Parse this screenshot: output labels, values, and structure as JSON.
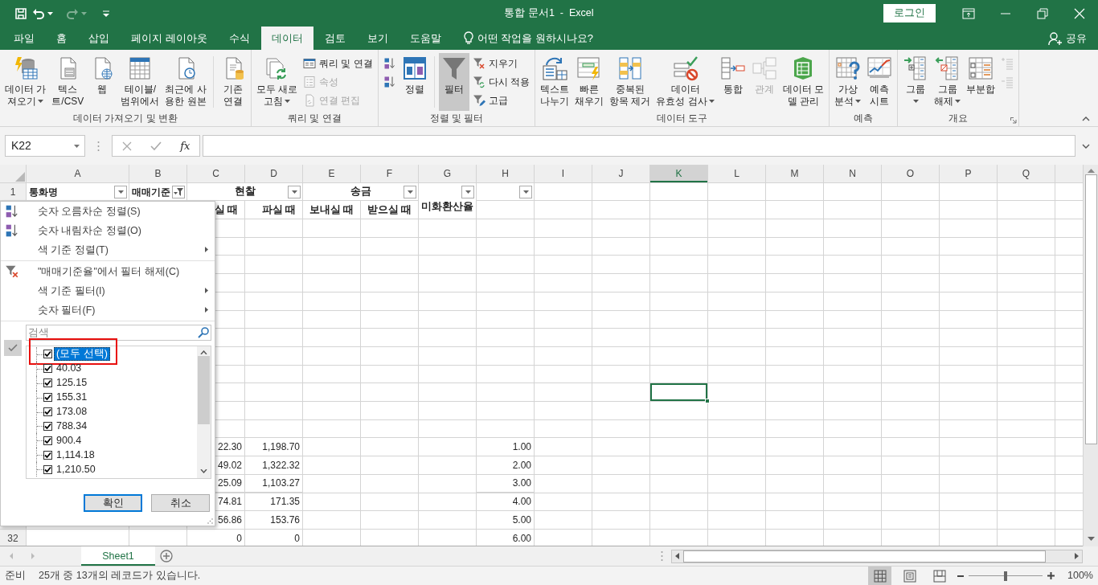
{
  "title_bar": {
    "quick_access": [
      {
        "kind": "save"
      },
      {
        "kind": "undo",
        "disabled": false
      },
      {
        "kind": "redo",
        "disabled": true
      },
      {
        "kind": "customize"
      }
    ],
    "title": "통합 문서1  -  Excel",
    "sign_in": "로그인"
  },
  "tabs": [
    {
      "label": "파일",
      "selected": false
    },
    {
      "label": "홈",
      "selected": false
    },
    {
      "label": "삽입",
      "selected": false
    },
    {
      "label": "페이지 레이아웃",
      "selected": false
    },
    {
      "label": "수식",
      "selected": false
    },
    {
      "label": "데이터",
      "selected": true
    },
    {
      "label": "검토",
      "selected": false
    },
    {
      "label": "보기",
      "selected": false
    },
    {
      "label": "도움말",
      "selected": false
    }
  ],
  "tell_me": "어떤 작업을 원하시나요?",
  "share": "공유",
  "ribbon": {
    "groups": [
      {
        "label": "데이터 가져오기 및 변환",
        "controls": [
          {
            "kind": "large",
            "lines": [
              "데이터 가",
              "져오기"
            ],
            "menu": true
          },
          {
            "kind": "large",
            "lines": [
              "텍스",
              "트/CSV"
            ]
          },
          {
            "kind": "large",
            "lines": [
              "웹"
            ]
          },
          {
            "kind": "large",
            "lines": [
              "테이블/",
              "범위에서"
            ]
          },
          {
            "kind": "large",
            "lines": [
              "최근에 사",
              "용한 원본"
            ]
          },
          {
            "kind": "separator"
          },
          {
            "kind": "large",
            "lines": [
              "기존",
              "연결"
            ]
          }
        ]
      },
      {
        "label": "쿼리 및 연결",
        "controls": [
          {
            "kind": "large",
            "lines": [
              "모두 새로",
              "고침"
            ],
            "menu": true
          },
          {
            "kind": "stack",
            "items": [
              {
                "label": "쿼리 및 연결",
                "disabled": false
              },
              {
                "label": "속성",
                "disabled": true
              },
              {
                "label": "연결 편집",
                "disabled": true
              }
            ]
          }
        ]
      },
      {
        "label": "정렬 및 필터",
        "controls": [
          {
            "kind": "stack",
            "items": [
              {
                "disabled": false
              },
              {
                "disabled": false
              }
            ]
          },
          {
            "kind": "large",
            "lines": [
              "정렬"
            ]
          },
          {
            "kind": "separator"
          },
          {
            "kind": "large",
            "lines": [
              "필터"
            ],
            "pressed": true
          },
          {
            "kind": "stack",
            "items": [
              {
                "label": "지우기",
                "disabled": false
              },
              {
                "label": "다시 적용",
                "disabled": false
              },
              {
                "label": "고급",
                "disabled": false
              }
            ]
          }
        ]
      },
      {
        "label": "데이터 도구",
        "controls": [
          {
            "kind": "large",
            "lines": [
              "텍스트",
              "나누기"
            ]
          },
          {
            "kind": "large",
            "lines": [
              "빠른",
              "채우기"
            ]
          },
          {
            "kind": "large",
            "lines": [
              "중복된",
              "항목 제거"
            ]
          },
          {
            "kind": "large",
            "lines": [
              "데이터",
              "유효성 검사"
            ],
            "menu": true
          },
          {
            "kind": "large",
            "lines": [
              "통합"
            ]
          },
          {
            "kind": "large",
            "lines": [
              "관계"
            ],
            "disabled": true
          },
          {
            "kind": "large",
            "lines": [
              "데이터 모",
              "델 관리"
            ]
          }
        ]
      },
      {
        "label": "예측",
        "controls": [
          {
            "kind": "large",
            "lines": [
              "가상",
              "분석"
            ],
            "menu": true
          },
          {
            "kind": "large",
            "lines": [
              "예측",
              "시트"
            ]
          }
        ]
      },
      {
        "label": "개요",
        "launcher": true,
        "controls": [
          {
            "kind": "large",
            "lines": [
              "그룹"
            ],
            "menu": true
          },
          {
            "kind": "large",
            "lines": [
              "그룹",
              "해제"
            ],
            "menu": true
          },
          {
            "kind": "large",
            "lines": [
              "부분합"
            ]
          },
          {
            "kind": "stack",
            "items": [
              {
                "disabled": true
              },
              {
                "disabled": true
              }
            ]
          }
        ]
      }
    ]
  },
  "formula_bar": {
    "name_box": "K22",
    "function_label": "fx"
  },
  "grid": {
    "columns": [
      {
        "label": "A",
        "active": false
      },
      {
        "label": "B",
        "active": false
      },
      {
        "label": "C",
        "active": false
      },
      {
        "label": "D",
        "active": false
      },
      {
        "label": "E",
        "active": false
      },
      {
        "label": "F",
        "active": false
      },
      {
        "label": "G",
        "active": false
      },
      {
        "label": "H",
        "active": false
      },
      {
        "label": "I",
        "active": false
      },
      {
        "label": "J",
        "active": false
      },
      {
        "label": "K",
        "active": true
      },
      {
        "label": "L",
        "active": false
      },
      {
        "label": "M",
        "active": false
      },
      {
        "label": "N",
        "active": false
      },
      {
        "label": "O",
        "active": false
      },
      {
        "label": "P",
        "active": false
      },
      {
        "label": "Q",
        "active": false
      }
    ],
    "header_rows": [
      {
        "number": "1",
        "cells": {
          "A": {
            "text": "통화명",
            "filter_button": true,
            "filtered": false
          },
          "B": {
            "text": "매매기준",
            "filter_button": true,
            "filtered": true
          },
          "C": {
            "text": "현찰",
            "merged_right": true,
            "filter_button": true,
            "filtered": false
          },
          "E": {
            "text": "송금",
            "merged_right": true,
            "filter_button": true,
            "filtered": false
          },
          "G": {
            "text": "미화환산율",
            "merged_down": true,
            "filter_button": true,
            "filtered": false
          },
          "H": {
            "filter_button": true,
            "filtered": false
          }
        }
      },
      {
        "cells": {
          "C": {
            "text": "실 때"
          },
          "D": {
            "text": "파실 때"
          },
          "E": {
            "text": "보내실 때"
          },
          "F": {
            "text": "받으실 때"
          }
        }
      }
    ],
    "rows": [
      {},
      {},
      {},
      {},
      {},
      {},
      {},
      {},
      {},
      {
        "active": true
      },
      {},
      {},
      {
        "cells": {
          "C": "22.30",
          "D": "1,198.70",
          "H": "1.00"
        }
      },
      {
        "cells": {
          "C": "49.02",
          "D": "1,322.32",
          "H": "2.00"
        }
      },
      {
        "cells": {
          "C": "25.09",
          "D": "1,103.27",
          "H": "3.00"
        }
      },
      {
        "cells": {
          "C": "74.81",
          "D": "171.35",
          "H": "4.00"
        }
      },
      {
        "cells": {
          "C": "56.86",
          "D": "153.76",
          "H": "5.00"
        }
      },
      {
        "number": "32",
        "cells": {
          "C": "0",
          "D": "0",
          "H": "6.00"
        }
      }
    ]
  },
  "filter_menu": {
    "commands": [
      {
        "kind": "sort-ascending",
        "label": "숫자 오름차순 정렬(S)"
      },
      {
        "kind": "sort-descending",
        "label": "숫자 내림차순 정렬(O)"
      },
      {
        "kind": "submenu",
        "label": "색 기준 정렬(T)"
      },
      {
        "kind": "separator"
      },
      {
        "kind": "clear-filter",
        "label": "\"매매기준율\"에서 필터 해제(C)"
      },
      {
        "kind": "submenu",
        "label": "색 기준 필터(I)"
      },
      {
        "kind": "submenu",
        "label": "숫자 필터(F)"
      },
      {
        "kind": "separator"
      }
    ],
    "search_placeholder": "검색",
    "values": [
      {
        "label": "(모두 선택)",
        "checked": true,
        "selected": true,
        "outlined": true
      },
      {
        "label": "40.03",
        "checked": true,
        "selected": false,
        "outlined": false
      },
      {
        "label": "125.15",
        "checked": true,
        "selected": false,
        "outlined": false
      },
      {
        "label": "155.31",
        "checked": true,
        "selected": false,
        "outlined": false
      },
      {
        "label": "173.08",
        "checked": true,
        "selected": false,
        "outlined": false
      },
      {
        "label": "788.34",
        "checked": true,
        "selected": false,
        "outlined": false
      },
      {
        "label": "900.4",
        "checked": true,
        "selected": false,
        "outlined": false
      },
      {
        "label": "1,114.18",
        "checked": true,
        "selected": false,
        "outlined": false
      },
      {
        "label": "1,210.50",
        "checked": true,
        "selected": false,
        "outlined": false
      }
    ],
    "buttons": [
      {
        "label": "확인",
        "focused": true
      },
      {
        "label": "취소",
        "focused": false
      }
    ]
  },
  "sheet_tabs": [
    {
      "label": "Sheet1",
      "selected": true
    }
  ],
  "status_bar": {
    "mode": "준비",
    "message": "25개 중 13개의 레코드가 있습니다.",
    "views": [
      {
        "selected": true
      },
      {
        "selected": false
      },
      {
        "selected": false
      }
    ],
    "zoom": {
      "level": 0.5,
      "reading": "100%"
    }
  }
}
